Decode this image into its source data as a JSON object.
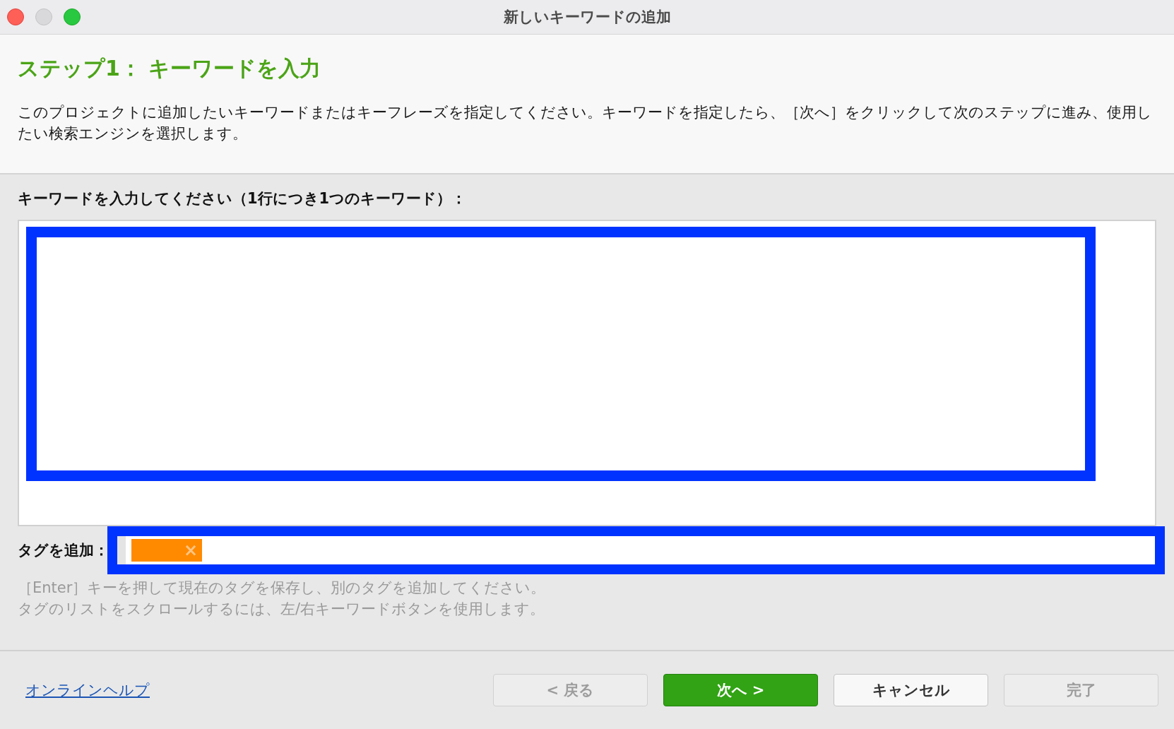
{
  "window": {
    "title": "新しいキーワードの追加"
  },
  "header": {
    "heading": "ステップ1： キーワードを入力",
    "description": "このプロジェクトに追加したいキーワードまたはキーフレーズを指定してください。キーワードを指定したら、［次へ］をクリックして次のステップに進み、使用したい検索エンジンを選択します。"
  },
  "keywords": {
    "label": "キーワードを入力してください（1行につき1つのキーワード）：",
    "highlighted": true
  },
  "tags": {
    "label": "タグを追加：",
    "highlighted": true,
    "items": [
      {
        "remove": "×"
      }
    ],
    "hints": [
      "［Enter］キーを押して現在のタグを保存し、別のタグを追加してください。",
      "タグのリストをスクロールするには、左/右キーワードボタンを使用します。"
    ]
  },
  "footer": {
    "help_link": "オンラインヘルプ",
    "buttons": [
      {
        "label": "< 戻る",
        "kind": "normal",
        "disabled": true
      },
      {
        "label": "次へ >",
        "kind": "primary",
        "disabled": false
      },
      {
        "label": "キャンセル",
        "kind": "normal",
        "disabled": false
      },
      {
        "label": "完了",
        "kind": "normal",
        "disabled": true
      }
    ]
  }
}
